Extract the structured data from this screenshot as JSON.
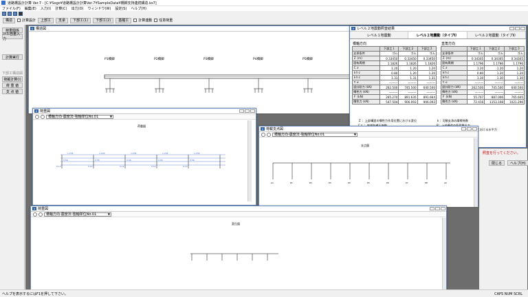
{
  "app": {
    "title": "道路橋設計計算 Ver.7 - [C:¥Sogo¥道路橋設計計算Ver.7¥SampleData¥橋脚支持連続構造.ks7]",
    "menus": [
      "ファイル(F)",
      "編集(E)",
      "入力(I)",
      "計算(C)",
      "出力(O)",
      "ウィンドウ(W)",
      "設定(S)",
      "ヘルプ(H)"
    ]
  },
  "toolbar2": {
    "items": [
      "構造",
      "計算設計",
      "上部工",
      "支承",
      "下部工(1)",
      "下部工(2)",
      "基礎工"
    ],
    "check_a": "計算連動",
    "check_b": "任意荷重"
  },
  "left_panel": {
    "buttons": [
      "荷重関係",
      "けた自重入力",
      "計算実行",
      "下部工構造図",
      "荷載計算(I)",
      "荷  重  値",
      "支  点  値"
    ]
  },
  "win_main": {
    "title": "構造図",
    "pier_labels": [
      "P1橋脚",
      "P2橋脚",
      "P3橋脚",
      "P4橋脚",
      "P5橋脚"
    ],
    "extra_label": "P6"
  },
  "win_results": {
    "title": "レベル２地震動照査結果",
    "tabs": [
      "レベル１地震動",
      "レベル２地震動（タイプⅠ）",
      "レベル２地震動（タイプⅡ）"
    ],
    "left_section": "橋軸方向",
    "right_section": "直角方向",
    "col_headers": [
      "",
      "下部工１",
      "下部工２",
      "下部工３"
    ],
    "rows_left": [
      [
        "支承条件",
        "ゴム",
        "ゴム",
        "ゴム"
      ],
      [
        "Ｚ (m)",
        "0.33450",
        "0.33450",
        "0.33450"
      ],
      [
        "固有周期",
        "1.1826",
        "1.1826",
        "1.1826"
      ],
      [
        "Ｃｚ",
        "1.20",
        "1.20",
        "1.20"
      ],
      [
        "ｋhｃ",
        "0.80",
        "1.20",
        "1.20"
      ],
      [
        "ｋhｃ",
        "1.31",
        "1.31",
        "1.31"
      ],
      [
        "ｔｅ",
        "———",
        "———",
        "———"
      ],
      [
        "設計耐力 (kN)",
        "262.500",
        "745.500",
        "640.500"
      ],
      [
        "慣性力 (kN)",
        "———",
        "———",
        "———"
      ],
      [
        "Ｆ (kN)",
        "265.270",
        "891.635",
        "891.664"
      ],
      [
        "慣性力 (kN)",
        "547.504",
        "906.093",
        "906.093"
      ]
    ],
    "rows_right": [
      [
        "支承条件",
        "ゴム",
        "ゴム",
        "ゴム"
      ],
      [
        "Ｚ (m)",
        "0.34305",
        "0.34305",
        "0.34305"
      ],
      [
        "固有周期",
        "1.1796",
        "1.1796",
        "1.1796"
      ],
      [
        "Ｃｚ",
        "1.20",
        "1.20",
        "1.20"
      ],
      [
        "ｋhｃ",
        "0.80",
        "1.20",
        "1.20"
      ],
      [
        "ｋhｃ",
        "1.30",
        "1.30",
        "1.30"
      ],
      [
        "ｔｅ",
        "———",
        "———",
        "———"
      ],
      [
        "設計耐力 (kN)",
        "262.500",
        "745.500",
        "640.500"
      ],
      [
        "慣性力 (kN)",
        "———",
        "———",
        "———"
      ],
      [
        "Ｆ (kN)",
        "55.707",
        "887.006",
        "765.605"
      ],
      [
        "慣性力 (kN)",
        "72.416",
        "1153.108",
        "1021.296"
      ]
    ],
    "legend_left": [
      "Ｚ ：上部構造の慣性力作用位置における変位",
      "Cｚ ：地域別補正係数",
      "kh0 ：設計水平震度の標準値",
      "kh ：設計水平震度"
    ],
    "legend_right": [
      "ｋ：可動支承の摩擦係数",
      "R：上部構造の死荷重反力",
      "Ｆ：上部構造の慣性力作用位置における水平力"
    ],
    "warning": "照査を行ってください。",
    "buttons": [
      "閉じる",
      "ヘルプ(H)"
    ]
  },
  "win_b": {
    "title": "荷重図",
    "select_value": "橋軸方向-震度法-強軸単位No.01",
    "caption": "荷重図"
  },
  "win_c": {
    "title": "荷載支点図",
    "select_value": "橋軸方向-震度法-強軸単位No.01",
    "caption": "支点図"
  },
  "win_d": {
    "title": "荷重図",
    "select_value": "橋軸方向-震度法-強軸単位No.01",
    "caption": "変位図"
  },
  "statusbar": {
    "text": "ヘルプを表示するにはF1を押して下さい。",
    "right": "CAPS  NUM  SCRL"
  }
}
